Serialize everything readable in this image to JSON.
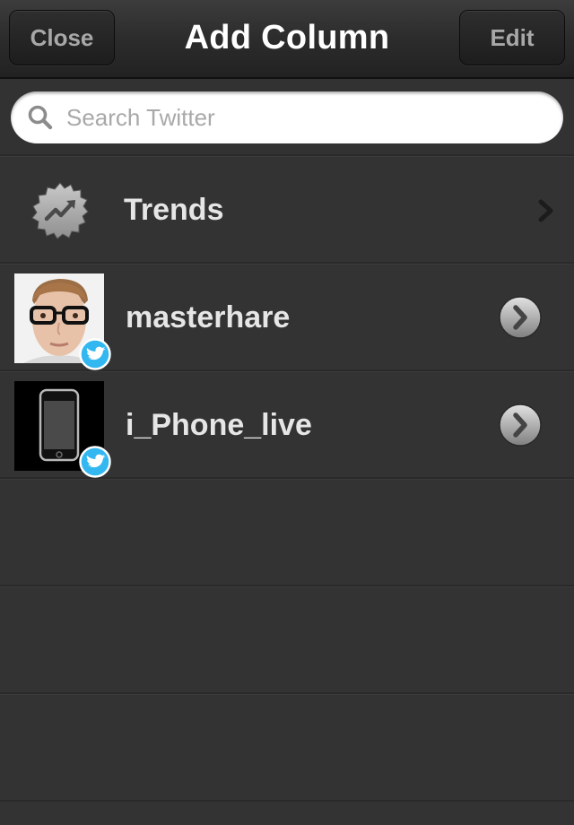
{
  "navbar": {
    "title": "Add Column",
    "close_label": "Close",
    "edit_label": "Edit"
  },
  "search": {
    "placeholder": "Search Twitter",
    "value": ""
  },
  "items": [
    {
      "label": "Trends",
      "icon": "trending-badge-icon",
      "accessory": "chevron-right-icon"
    },
    {
      "label": "masterhare",
      "icon": "twitter-badge-icon",
      "accessory": "disclosure-button-icon"
    },
    {
      "label": "i_Phone_live",
      "icon": "twitter-badge-icon",
      "accessory": "disclosure-button-icon"
    }
  ],
  "colors": {
    "background": "#333333",
    "navbar": "#2c2c2c",
    "text": "#e6e6e6",
    "twitter_blue": "#33b7f0"
  }
}
